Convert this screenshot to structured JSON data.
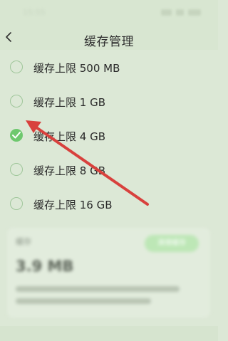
{
  "status_bar": {
    "time": "15:55",
    "icons": [
      "signal-icon",
      "wifi-icon",
      "battery-icon"
    ]
  },
  "header": {
    "title": "缓存管理",
    "back_icon": "chevron-left-icon"
  },
  "cache_limit_options": [
    {
      "label": "缓存上限 500 MB",
      "selected": false
    },
    {
      "label": "缓存上限 1 GB",
      "selected": false
    },
    {
      "label": "缓存上限 4 GB",
      "selected": true
    },
    {
      "label": "缓存上限 8 GB",
      "selected": false
    },
    {
      "label": "缓存上限 16 GB",
      "selected": false
    }
  ],
  "cache_card": {
    "title": "缓存",
    "size": "3.9 MB",
    "clear_button_label": "清理缓存"
  },
  "colors": {
    "selected_radio": "#6ec86e",
    "annotation_arrow": "#d8413d",
    "background": "#dce8d6"
  }
}
